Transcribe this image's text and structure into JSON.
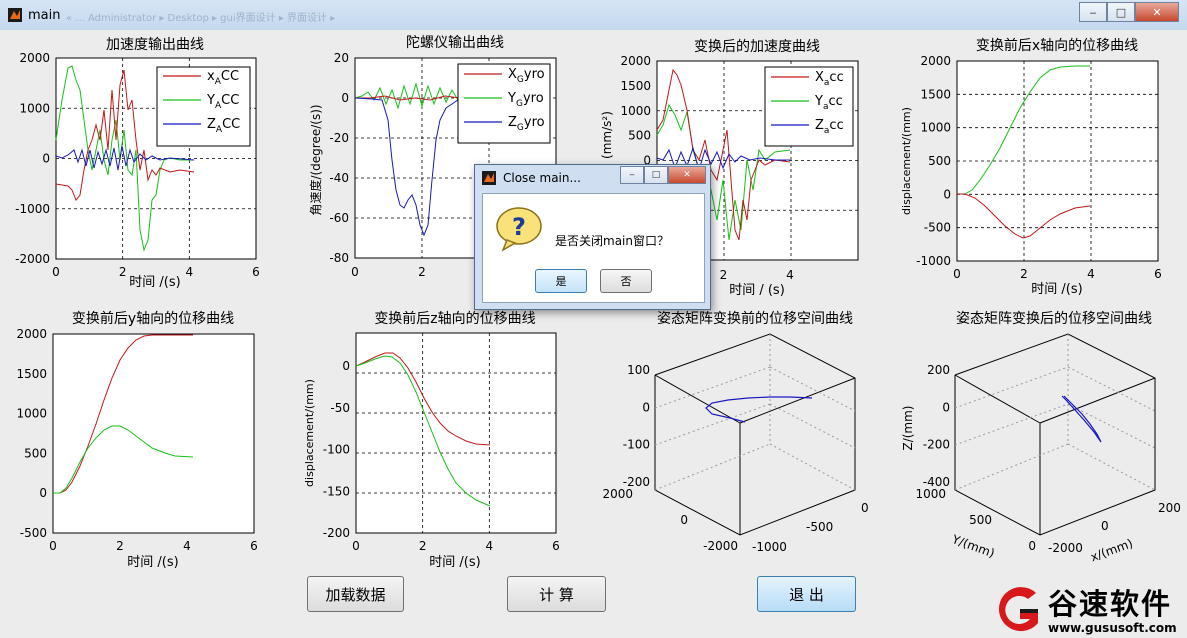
{
  "window": {
    "title": "main",
    "ghost_path": "« ... Administrator ▸ Desktop ▸ gui界面设计 ▸ 界面设计 ▸",
    "controls": {
      "min": "‒",
      "max": "□",
      "close": "✕"
    }
  },
  "plots": [
    {
      "title": "加速度输出曲线",
      "xlabel": "时间 /(s)",
      "ylabel": "",
      "xticks": [
        "0",
        "2",
        "4",
        "6"
      ],
      "yticks": [
        "2000",
        "1000",
        "0",
        "-1000",
        "-2000"
      ],
      "legend": [
        {
          "main": "x",
          "sub": "A",
          "tail": "CC",
          "color": "#c01818"
        },
        {
          "main": "Y",
          "sub": "A",
          "tail": "CC",
          "color": "#18c018"
        },
        {
          "main": "Z",
          "sub": "A",
          "tail": "CC",
          "color": "#1818c0"
        }
      ]
    },
    {
      "title": "陀螺仪输出曲线",
      "xlabel": "时间 /(s)",
      "ylabel": "角速度/(degree/(s))",
      "xticks": [
        "0",
        "2",
        "4",
        "6"
      ],
      "yticks": [
        "20",
        "0",
        "-20",
        "-40",
        "-60",
        "-80"
      ],
      "legend": [
        {
          "main": "X",
          "sub": "G",
          "tail": "yro",
          "color": "#c01818"
        },
        {
          "main": "Y",
          "sub": "G",
          "tail": "yro",
          "color": "#18c018"
        },
        {
          "main": "Z",
          "sub": "G",
          "tail": "yro",
          "color": "#1818c0"
        }
      ]
    },
    {
      "title": "变换后的加速度曲线",
      "xlabel": "时间 / (s)",
      "ylabel": "(mm/s²)",
      "xticks": [
        "0",
        "2",
        "4"
      ],
      "yticks": [
        "2000",
        "1500",
        "1000",
        "500",
        "0",
        "-500",
        "-1000",
        "-1500",
        "-2000"
      ],
      "legend": [
        {
          "main": "X",
          "sub": "a",
          "tail": "cc",
          "color": "#c01818"
        },
        {
          "main": "Y",
          "sub": "a",
          "tail": "cc",
          "color": "#18c018"
        },
        {
          "main": "Z",
          "sub": "a",
          "tail": "cc",
          "color": "#1818c0"
        }
      ]
    },
    {
      "title": "变换前后x轴向的位移曲线",
      "xlabel": "时间 /(s)",
      "ylabel": "displacement/(mm)",
      "xticks": [
        "0",
        "2",
        "4",
        "6"
      ],
      "yticks": [
        "2000",
        "1500",
        "1000",
        "500",
        "0",
        "-500",
        "-1000"
      ]
    },
    {
      "title": "变换前后y轴向的位移曲线",
      "xlabel": "时间 /(s)",
      "ylabel": "displacement/(mm)",
      "xticks": [
        "0",
        "2",
        "4",
        "6"
      ],
      "yticks": [
        "2000",
        "1500",
        "1000",
        "500",
        "0",
        "-500"
      ]
    },
    {
      "title": "变换前后z轴向的位移曲线",
      "xlabel": "时间 /(s)",
      "ylabel": "displacement/(mm)",
      "xticks": [
        "0",
        "2",
        "4",
        "6"
      ],
      "yticks": [
        "0",
        "-50",
        "-100",
        "-150",
        "-200"
      ]
    },
    {
      "title": "姿态矩阵变换前的位移空间曲线",
      "xlabel": "",
      "ylabel": "",
      "zticks": [
        "100",
        "0",
        "-100",
        "-200"
      ],
      "yaxis_ticks": [
        "2000",
        "0",
        "-2000"
      ],
      "xaxis_ticks": [
        "-1000",
        "-500",
        "0"
      ]
    },
    {
      "title": "姿态矩阵变换后的位移空间曲线",
      "xlabel": "x/(mm)",
      "ylabel": "Y/(mm)",
      "zlabel": "Z/(mm)",
      "zticks": [
        "200",
        "0",
        "-200",
        "-400"
      ],
      "yaxis_ticks": [
        "1000",
        "500",
        "0"
      ],
      "xaxis_ticks": [
        "-2000",
        "0",
        "200"
      ]
    }
  ],
  "buttons": {
    "load": "加载数据",
    "compute": "计 算",
    "exit": "退 出"
  },
  "dialog": {
    "title": "Close main...",
    "message": "是否关闭main窗口？",
    "yes": "是",
    "no": "否",
    "icon": "question-icon"
  },
  "watermark": {
    "brand": "谷速软件",
    "url": "www.gususoft.com"
  },
  "colors": {
    "red": "#c01818",
    "green": "#18c018",
    "blue": "#1818c0"
  }
}
